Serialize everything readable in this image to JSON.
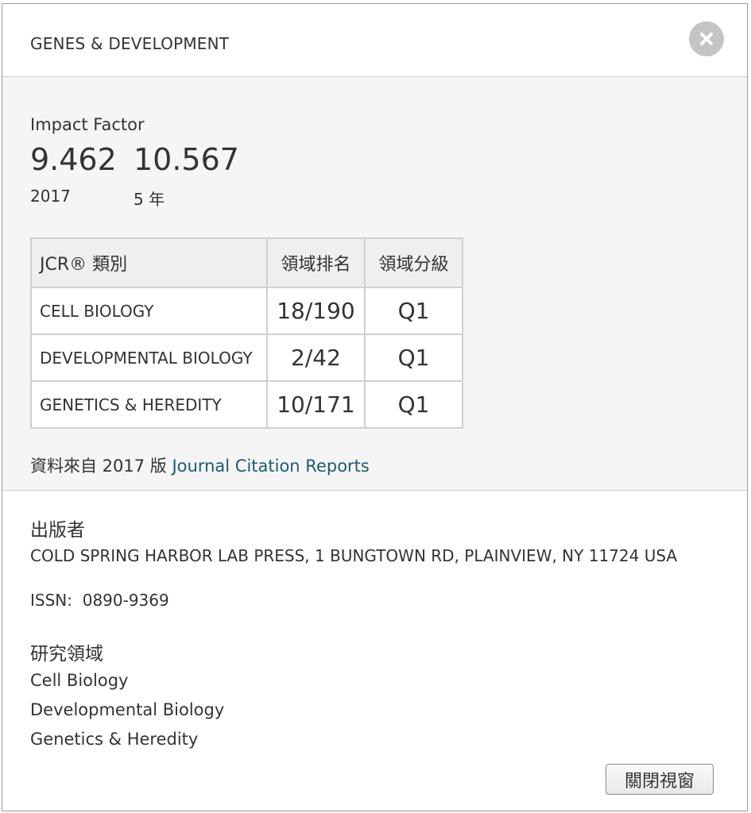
{
  "modal": {
    "title": "GENES & DEVELOPMENT",
    "close_icon": "close-icon",
    "close_window_label": "關閉視窗"
  },
  "impact_factor": {
    "label": "Impact Factor",
    "values": [
      {
        "value": "9.462",
        "sub": "2017"
      },
      {
        "value": "10.567",
        "sub": "5 年"
      }
    ]
  },
  "jcr_table": {
    "headers": {
      "category": "JCR® 類別",
      "rank": "領域排名",
      "quartile": "領域分級"
    },
    "rows": [
      {
        "category": "CELL BIOLOGY",
        "rank": "18/190",
        "quartile": "Q1"
      },
      {
        "category": "DEVELOPMENTAL BIOLOGY",
        "rank": "2/42",
        "quartile": "Q1"
      },
      {
        "category": "GENETICS & HEREDITY",
        "rank": "10/171",
        "quartile": "Q1"
      }
    ]
  },
  "source": {
    "prefix": "資料來自 2017 版 ",
    "link_text": "Journal Citation Reports"
  },
  "publisher": {
    "label": "出版者",
    "address": "COLD SPRING HARBOR LAB PRESS, 1 BUNGTOWN RD, PLAINVIEW, NY 11724 USA"
  },
  "issn": {
    "label": "ISSN:",
    "value": "0890-9369"
  },
  "research_areas": {
    "label": "研究領域",
    "items": [
      "Cell Biology",
      "Developmental Biology",
      "Genetics & Heredity"
    ]
  },
  "colors": {
    "link": "#1d5c6e",
    "section_bg": "#f5f5f5",
    "close_icon_bg": "#c4c4c4"
  }
}
